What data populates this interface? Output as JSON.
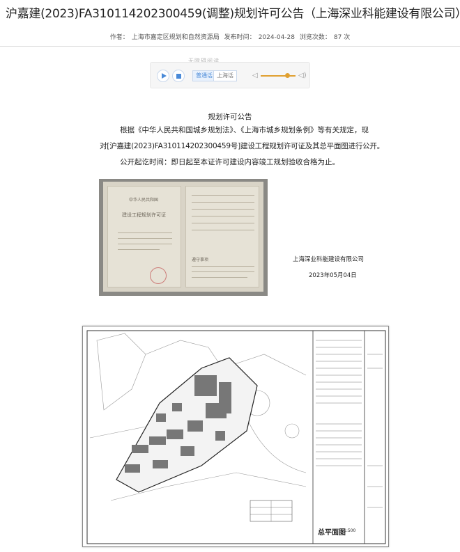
{
  "article": {
    "title": "沪嘉建(2023)FA310114202300459(调整)规划许可公告（上海深业科能建设有限公司）",
    "author_label": "作者：",
    "author": "上海市嘉定区规划和自然资源局",
    "publish_label": "发布时间：",
    "publish_time": "2024-04-28",
    "views_label": "浏览次数：",
    "views": "87 次"
  },
  "player": {
    "caption": "无障碍阅读",
    "lang_mandarin": "普通话",
    "lang_shanghai": "上海话",
    "volume_level": 0.7,
    "accent": "#4a8ad8",
    "volume_color": "#e0a030"
  },
  "notice": {
    "heading": "规划许可公告",
    "line1": "根据《中华人民共和国城乡规划法》、《上海市城乡规划条例》等有关规定，现",
    "line2": "对[沪嘉建(2023)FA310114202300459号]建设工程规划许可证及其总平面图进行公开。",
    "line3": "公开起讫时间：即日起至本证许可建设内容竣工规划验收合格为止。",
    "company": "上海深业科能建设有限公司",
    "date": "2023年05月04日"
  },
  "permit_image": {
    "header": "中华人民共和国",
    "doc_name": "建设工程规划许可证",
    "notice_heading": "遵守事项"
  },
  "site_plan": {
    "title": "总平面图",
    "scale": "1:500"
  }
}
